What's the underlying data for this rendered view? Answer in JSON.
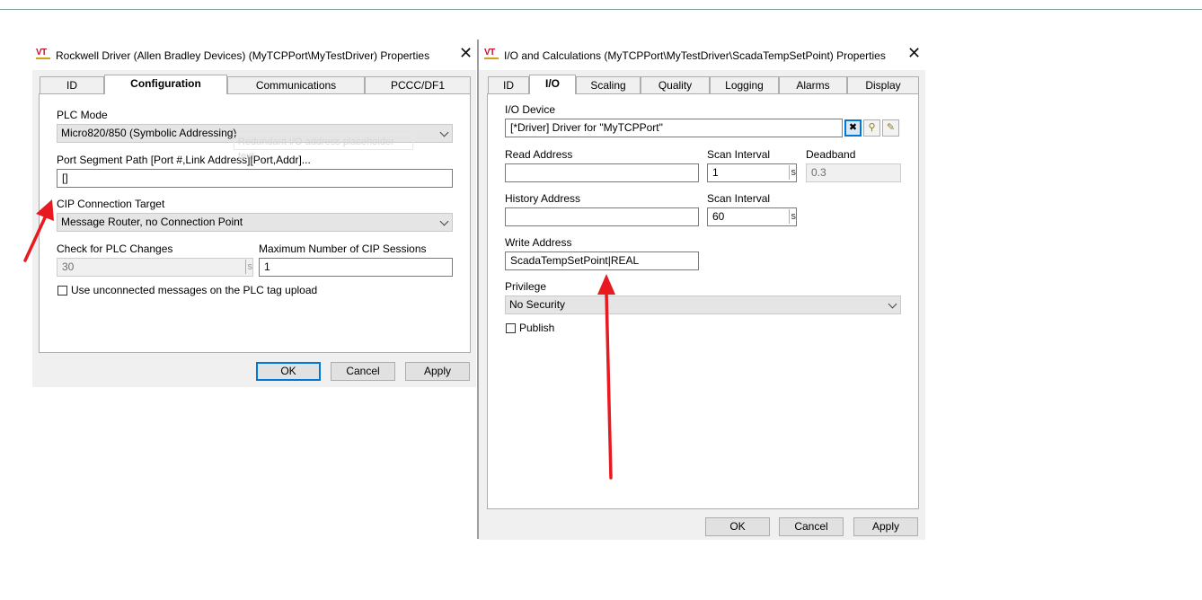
{
  "left_dialog": {
    "title": "Rockwell Driver (Allen Bradley Devices) (MyTCPPort\\MyTestDriver) Properties",
    "logo_text": "VT",
    "close_glyph": "✕",
    "tabs": [
      {
        "label": "ID",
        "active": false
      },
      {
        "label": "Configuration",
        "active": true
      },
      {
        "label": "Communications",
        "active": false
      },
      {
        "label": "PCCC/DF1",
        "active": false
      }
    ],
    "plc_mode": {
      "label": "PLC Mode",
      "value": "Micro820/850 (Symbolic Addressing)"
    },
    "ghost_text": "Redundant I/O address placeholder text",
    "port_segment": {
      "label": "Port Segment Path [Port #,Link Address][Port,Addr]...",
      "value": "[]"
    },
    "cip_target": {
      "label": "CIP Connection Target",
      "value": "Message Router, no Connection Point"
    },
    "check_plc": {
      "label": "Check for PLC Changes",
      "value": "30",
      "unit": "s"
    },
    "max_sessions": {
      "label": "Maximum Number of CIP Sessions",
      "value": "1"
    },
    "unconnected": {
      "label": "Use unconnected messages on the PLC tag upload",
      "checked": false
    },
    "buttons": {
      "ok": "OK",
      "cancel": "Cancel",
      "apply": "Apply"
    }
  },
  "right_dialog": {
    "title": "I/O and Calculations (MyTCPPort\\MyTestDriver\\ScadaTempSetPoint) Properties",
    "logo_text": "VT",
    "close_glyph": "✕",
    "tabs": [
      {
        "label": "ID",
        "active": false
      },
      {
        "label": "I/O",
        "active": true
      },
      {
        "label": "Scaling",
        "active": false
      },
      {
        "label": "Quality",
        "active": false
      },
      {
        "label": "Logging",
        "active": false
      },
      {
        "label": "Alarms",
        "active": false
      },
      {
        "label": "Display",
        "active": false
      }
    ],
    "io_device": {
      "label": "I/O Device",
      "value": "[*Driver]    Driver for \"MyTCPPort\""
    },
    "device_icons": {
      "clear": "✖",
      "browse": "⚲",
      "edit": "✎"
    },
    "read_address": {
      "label": "Read Address",
      "value": ""
    },
    "scan_interval_1": {
      "label": "Scan Interval",
      "value": "1",
      "unit": "s"
    },
    "deadband": {
      "label": "Deadband",
      "value": "0.3"
    },
    "history_address": {
      "label": "History Address",
      "value": ""
    },
    "scan_interval_2": {
      "label": "Scan Interval",
      "value": "60",
      "unit": "s"
    },
    "write_address": {
      "label": "Write Address",
      "value": "ScadaTempSetPoint|REAL"
    },
    "privilege": {
      "label": "Privilege",
      "value": "No Security"
    },
    "publish": {
      "label": "Publish",
      "checked": false
    },
    "buttons": {
      "ok": "OK",
      "cancel": "Cancel",
      "apply": "Apply"
    }
  },
  "annotation_color": "#e8191f"
}
